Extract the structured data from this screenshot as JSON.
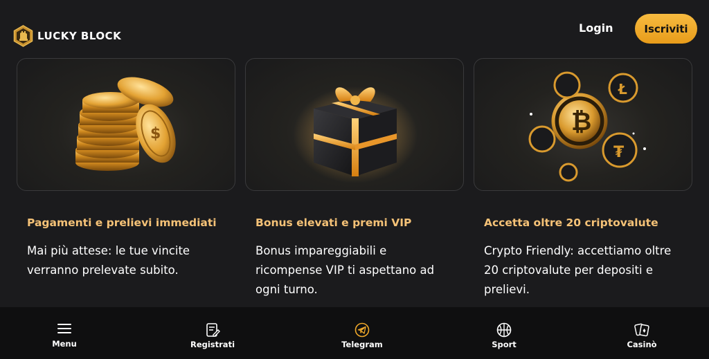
{
  "header": {
    "logo_text": "LUCKY BLOCK",
    "login_label": "Login",
    "signup_label": "Iscriviti"
  },
  "colors": {
    "accent": "#f5c277",
    "button": "#f0a92a",
    "background": "#1b1b1d",
    "nav_background": "#0f0f10"
  },
  "features": [
    {
      "image": "gold-coins-stack",
      "title": "Pagamenti e prelievi immediati",
      "description": "Mai più attese: le tue vincite verranno prelevate subito."
    },
    {
      "image": "gift-box",
      "title": "Bonus elevati e premi VIP",
      "description": "Bonus impareggiabili e ricompense VIP ti aspettano ad ogni turno."
    },
    {
      "image": "crypto-coins",
      "title": "Accetta oltre 20 criptovalute",
      "description": "Crypto Friendly: accettiamo oltre 20 criptovalute per depositi e prelievi."
    }
  ],
  "bottom_nav": [
    {
      "label": "Menu",
      "icon": "hamburger-icon"
    },
    {
      "label": "Registrati",
      "icon": "register-icon"
    },
    {
      "label": "Telegram",
      "icon": "telegram-icon"
    },
    {
      "label": "Sport",
      "icon": "basketball-icon"
    },
    {
      "label": "Casinò",
      "icon": "cards-icon"
    }
  ]
}
